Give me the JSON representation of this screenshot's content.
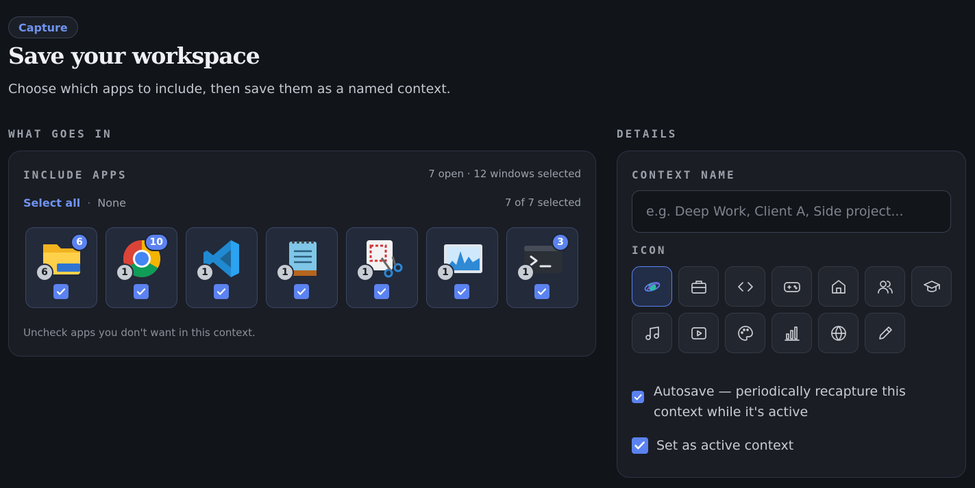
{
  "header": {
    "pill": "Capture",
    "title": "Save your workspace",
    "subtitle": "Choose which apps to include, then save them as a named context."
  },
  "sections": {
    "left": "WHAT GOES IN",
    "right": "DETAILS"
  },
  "include": {
    "label": "INCLUDE APPS",
    "summary": "7 open · 12 windows selected",
    "select_all": "Select all",
    "separator": "·",
    "none": "None",
    "selected_count": "7 of 7 selected",
    "hint": "Uncheck apps you don't want in this context.",
    "apps": [
      {
        "icon": "file-explorer-icon",
        "windows_badge": "6",
        "instances_badge": "6",
        "checked": true
      },
      {
        "icon": "chrome-icon",
        "windows_badge": "10",
        "instances_badge": "1",
        "checked": true
      },
      {
        "icon": "vscode-icon",
        "windows_badge": "",
        "instances_badge": "1",
        "checked": true
      },
      {
        "icon": "notepad-icon",
        "windows_badge": "",
        "instances_badge": "1",
        "checked": true
      },
      {
        "icon": "snipping-tool-icon",
        "windows_badge": "",
        "instances_badge": "1",
        "checked": true
      },
      {
        "icon": "resource-monitor-icon",
        "windows_badge": "",
        "instances_badge": "1",
        "checked": true
      },
      {
        "icon": "terminal-icon",
        "windows_badge": "3",
        "instances_badge": "1",
        "checked": true
      }
    ]
  },
  "details": {
    "context_name_label": "CONTEXT NAME",
    "context_name_value": "",
    "context_name_placeholder": "e.g. Deep Work, Client A, Side project...",
    "icon_label": "ICON",
    "icons": [
      "swirl-icon",
      "briefcase-icon",
      "code-icon",
      "gamepad-icon",
      "home-icon",
      "users-icon",
      "graduation-cap-icon",
      "music-icon",
      "play-icon",
      "palette-icon",
      "bar-chart-icon",
      "globe-icon",
      "pencil-icon"
    ],
    "selected_icon": "swirl-icon",
    "autosave_label": "Autosave — periodically recapture this context while it's active",
    "autosave_checked": true,
    "active_label": "Set as active context",
    "active_checked": true
  },
  "colors": {
    "accent": "#5b82f0",
    "background": "#111419",
    "card": "#1a1d24"
  }
}
